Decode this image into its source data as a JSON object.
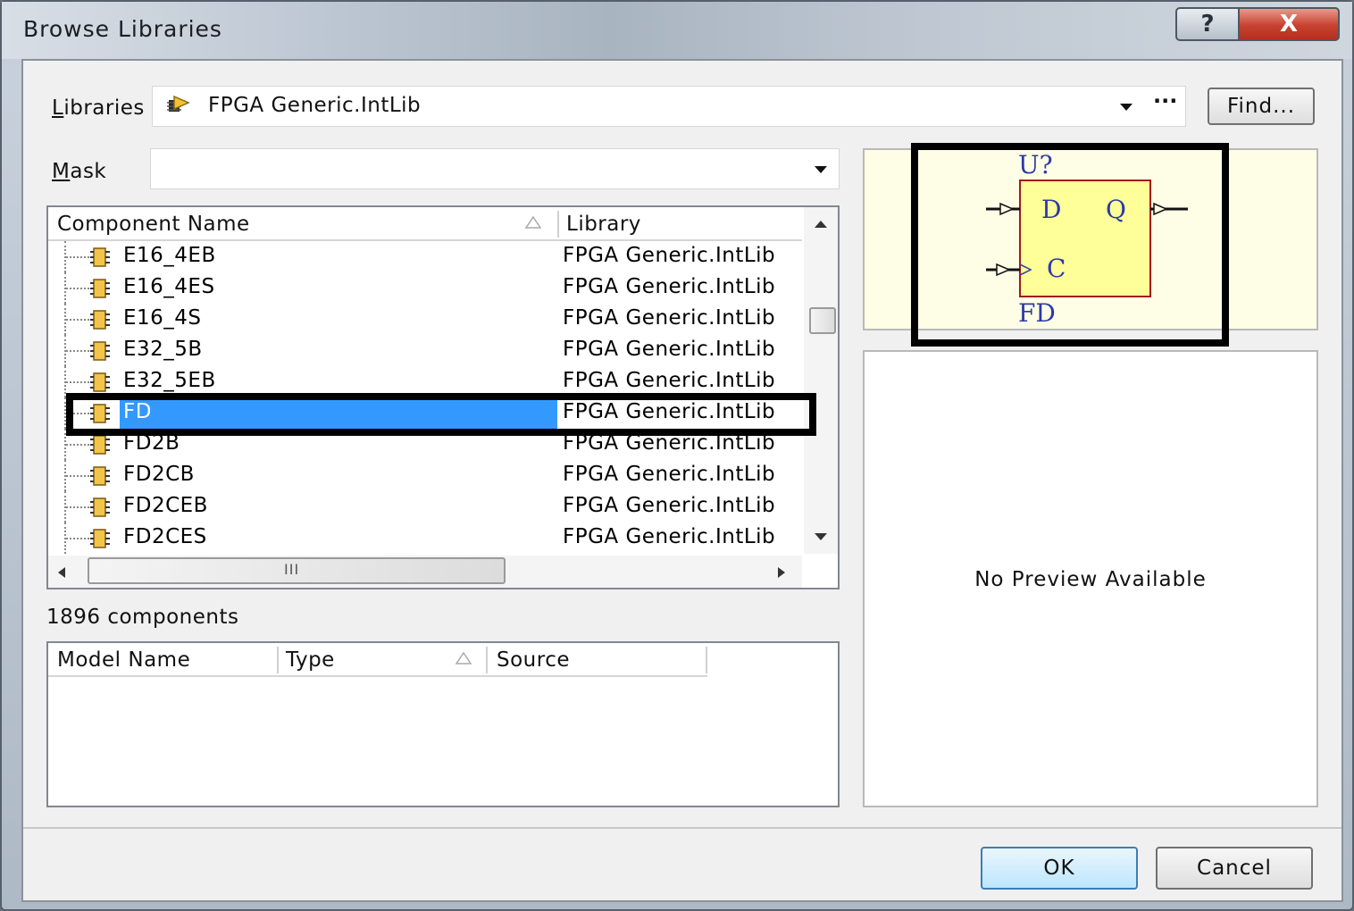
{
  "window": {
    "title": "Browse Libraries",
    "help_label": "?",
    "close_label": "X"
  },
  "libraries": {
    "label_u": "L",
    "label_rest": "ibraries",
    "value": "FPGA Generic.IntLib",
    "dropdown_icon": "chevron-down-icon",
    "more_label": "···",
    "find_label": "Find..."
  },
  "mask": {
    "label_u": "M",
    "label_rest": "ask",
    "value": ""
  },
  "components": {
    "headers": {
      "name": "Component Name",
      "library": "Library"
    },
    "rows": [
      {
        "name": "E16_4EB",
        "library": "FPGA Generic.IntLib",
        "selected": false
      },
      {
        "name": "E16_4ES",
        "library": "FPGA Generic.IntLib",
        "selected": false
      },
      {
        "name": "E16_4S",
        "library": "FPGA Generic.IntLib",
        "selected": false
      },
      {
        "name": "E32_5B",
        "library": "FPGA Generic.IntLib",
        "selected": false
      },
      {
        "name": "E32_5EB",
        "library": "FPGA Generic.IntLib",
        "selected": false
      },
      {
        "name": "FD",
        "library": "FPGA Generic.IntLib",
        "selected": true
      },
      {
        "name": "FD2B",
        "library": "FPGA Generic.IntLib",
        "selected": false
      },
      {
        "name": "FD2CB",
        "library": "FPGA Generic.IntLib",
        "selected": false
      },
      {
        "name": "FD2CEB",
        "library": "FPGA Generic.IntLib",
        "selected": false
      },
      {
        "name": "FD2CES",
        "library": "FPGA Generic.IntLib",
        "selected": false
      }
    ],
    "count_text": "1896 components"
  },
  "models": {
    "headers": {
      "name": "Model Name",
      "type": "Type",
      "source": "Source"
    }
  },
  "preview": {
    "designator": "U?",
    "part": "FD",
    "pin_d": "D",
    "pin_q": "Q",
    "pin_c": "C",
    "no_preview": "No Preview Available"
  },
  "buttons": {
    "ok": "OK",
    "cancel": "Cancel"
  },
  "colors": {
    "selection": "#3399ff",
    "symbol_fill": "#ffff99",
    "symbol_border": "#a01818",
    "symbol_text": "#2b3aa6",
    "preview_bg": "#fefee6"
  }
}
